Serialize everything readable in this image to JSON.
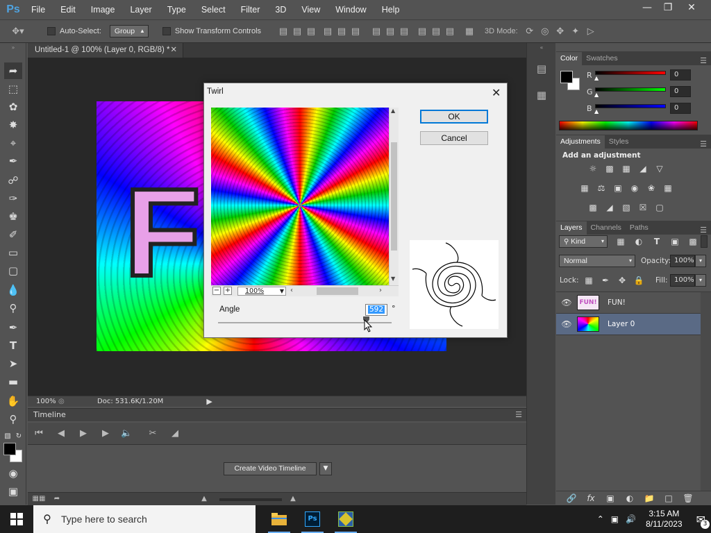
{
  "app": {
    "logo": "Ps"
  },
  "menu": [
    "File",
    "Edit",
    "Image",
    "Layer",
    "Type",
    "Select",
    "Filter",
    "3D",
    "View",
    "Window",
    "Help"
  ],
  "options_bar": {
    "auto_select_label": "Auto-Select:",
    "auto_select_value": "Group",
    "show_transform_label": "Show Transform Controls",
    "mode_3d_label": "3D Mode:"
  },
  "document": {
    "tab_title": "Untitled-1 @ 100% (Layer 0, RGB/8) *",
    "canvas_text": "F",
    "zoom": "100%",
    "doc_info": "Doc: 531.6K/1.20M"
  },
  "timeline": {
    "title": "Timeline",
    "create_button": "Create Video Timeline"
  },
  "color_panel": {
    "tabs": [
      "Color",
      "Swatches"
    ],
    "channels": [
      {
        "label": "R",
        "value": "0",
        "color": "#ff0000"
      },
      {
        "label": "G",
        "value": "0",
        "color": "#00ff00"
      },
      {
        "label": "B",
        "value": "0",
        "color": "#0000ff"
      }
    ]
  },
  "adjustments_panel": {
    "tabs": [
      "Adjustments",
      "Styles"
    ],
    "heading": "Add an adjustment"
  },
  "layers_panel": {
    "tabs": [
      "Layers",
      "Channels",
      "Paths"
    ],
    "filter_kind": "Kind",
    "blend_mode": "Normal",
    "opacity_label": "Opacity:",
    "opacity_value": "100%",
    "lock_label": "Lock:",
    "fill_label": "Fill:",
    "fill_value": "100%",
    "layers": [
      {
        "name": "FUN!",
        "thumb_text": "FUN!",
        "selected": false
      },
      {
        "name": "Layer 0",
        "thumb_text": "",
        "selected": true
      }
    ]
  },
  "twirl_dialog": {
    "title": "Twirl",
    "ok_label": "OK",
    "cancel_label": "Cancel",
    "preview_zoom": "100%",
    "angle_label": "Angle",
    "angle_value": "592",
    "angle_unit": "°"
  },
  "taskbar": {
    "search_placeholder": "Type here to search",
    "time": "3:15 AM",
    "date": "8/11/2023",
    "notification_count": "3",
    "apps": [
      "file-explorer",
      "photoshop",
      "app-3"
    ]
  },
  "colors": {
    "accent": "#0078d7",
    "panel": "#535353",
    "selected_layer": "#5a6a85"
  }
}
